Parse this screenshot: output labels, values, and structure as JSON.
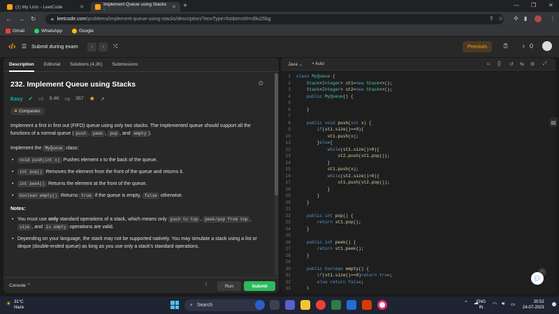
{
  "browser": {
    "tabs": [
      {
        "label": "(1) My Lists - LeetCode"
      },
      {
        "label": "Implement Queue using Stacks -"
      }
    ],
    "url_host": "leetcode.com",
    "url_path": "/problems/implement-queue-using-stacks/description/?envType=list&envId=rd9u25bg",
    "bookmarks": [
      {
        "label": "Gmail"
      },
      {
        "label": "WhatsApp"
      },
      {
        "label": "Google"
      }
    ]
  },
  "lc_header": {
    "title": "Submit during exam",
    "premium_label": "Premium",
    "coins": "0"
  },
  "left": {
    "tabs": [
      "Description",
      "Editorial",
      "Solutions (4.2K)",
      "Submissions"
    ],
    "title": "232. Implement Queue using Stacks",
    "difficulty": "Easy",
    "likes": "6.4K",
    "dislikes": "367",
    "companies": "Companies",
    "intro_1": "Implement a first in first out (FIFO) queue using only two stacks. The implemented queue should support all the functions of a normal queue (",
    "intro_codes": [
      "push",
      "peek",
      "pop",
      "empty"
    ],
    "impl_prefix": "Implement the",
    "impl_class": "MyQueue",
    "impl_suffix": "class:",
    "methods": [
      {
        "sig": "void push(int x)",
        "desc": "Pushes element x to the back of the queue."
      },
      {
        "sig": "int pop()",
        "desc": "Removes the element from the front of the queue and returns it."
      },
      {
        "sig": "int peek()",
        "desc": "Returns the element at the front of the queue."
      },
      {
        "sig": "boolean empty()",
        "desc_pre": "Returns",
        "true": "true",
        "desc_mid": "if the queue is empty,",
        "false": "false",
        "desc_post": "otherwise."
      }
    ],
    "notes_label": "Notes:",
    "note1_pre": "You must use",
    "note1_bold": "only",
    "note1_mid": "standard operations of a stack, which means only",
    "note1_codes": [
      "push to top",
      "peek/pop from top",
      "size",
      "is empty"
    ],
    "note1_post": "operations are valid.",
    "note2": "Depending on your language, the stack may not be supported natively. You may simulate a stack using a list or deque (double-ended queue) as long as you use only a stack's standard operations.",
    "console_label": "Console",
    "run_label": "Run",
    "submit_label": "Submit"
  },
  "editor": {
    "language": "Java",
    "mode": "Auto",
    "lines": [
      "class MyQueue {",
      "    Stack<Integer> st1=new Stack<>();",
      "    Stack<Integer> st2=new Stack<>();",
      "    public MyQueue() {",
      "",
      "    }",
      "",
      "    public void push(int x) {",
      "        if(st1.size()==0){",
      "            st1.push(x);",
      "        }else{",
      "            while(st1.size()>0){",
      "                st2.push(st1.pop());",
      "            }",
      "            st1.push(x);",
      "            while(st2.size()>0){",
      "                st1.push(st2.pop());",
      "            }",
      "        }",
      "    }",
      "",
      "    public int pop() {",
      "        return st1.pop();",
      "    }",
      "",
      "    public int peek() {",
      "        return st1.peek();",
      "    }",
      "",
      "    public boolean empty() {",
      "        if(st1.size()==0)return true;",
      "        else return false;",
      "    }"
    ]
  },
  "taskbar": {
    "temp": "31°C",
    "weather": "Haze",
    "search": "Search",
    "lang1": "ENG",
    "lang2": "IN",
    "time": "20:52",
    "date": "24-07-2023"
  },
  "colors": {
    "accent": "#ffa116",
    "easy": "#00b8a3",
    "submit": "#2cbb5d"
  }
}
